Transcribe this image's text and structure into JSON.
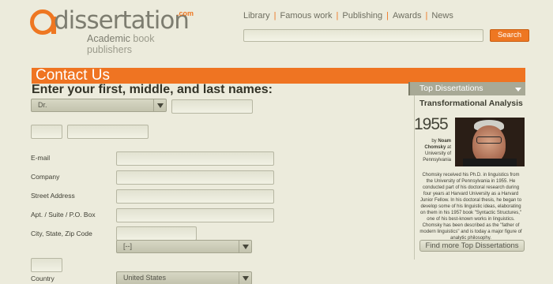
{
  "logo": {
    "word": "dissertation",
    "tld": ".com",
    "tagline_strong": "Academic",
    "tagline_rest": " book publishers"
  },
  "nav": {
    "items": [
      "Library",
      "Famous work",
      "Publishing",
      "Awards",
      "News"
    ],
    "separator": "|"
  },
  "search": {
    "value": "",
    "button_label": "Search"
  },
  "page": {
    "title": "Contact Us",
    "form_heading": "Enter your first, middle, and last names:"
  },
  "form": {
    "title_select_value": "Dr.",
    "fields": {
      "email": "E-mail",
      "company": "Company",
      "street": "Street Address",
      "apt": "Apt. / Suite / P.O. Box",
      "city": "City, State, Zip Code",
      "country": "Country"
    },
    "state_select_value": "[--]",
    "country_select_value": "United States"
  },
  "sidebar": {
    "tab_label": "Top Dissertations",
    "title": "Transformational Analysis",
    "year": "1955",
    "byline_prefix": "by ",
    "author": "Noam Chomsky",
    "byline_suffix": " at University of Pennsylvania",
    "description": "Chomsky received his Ph.D. in linguistics from the University of Pennsylvania in 1955. He conducted part of his doctoral research during four years at Harvard University as a Harvard Junior Fellow. In his doctoral thesis, he began to develop some of his linguistic ideas, elaborating on them in his 1957 book \"Syntactic Structures,\" one of his best-known works in linguistics. Chomsky has been described as the \"father of modern linguistics\" and is today a major figure of analytic philosophy.",
    "more_button": "Find more Top Dissertations"
  },
  "colors": {
    "accent": "#ef7422",
    "background": "#ecebdc"
  },
  "icons": {
    "select_arrow": "triangle-down",
    "tab_chevron": "chevron-down"
  }
}
